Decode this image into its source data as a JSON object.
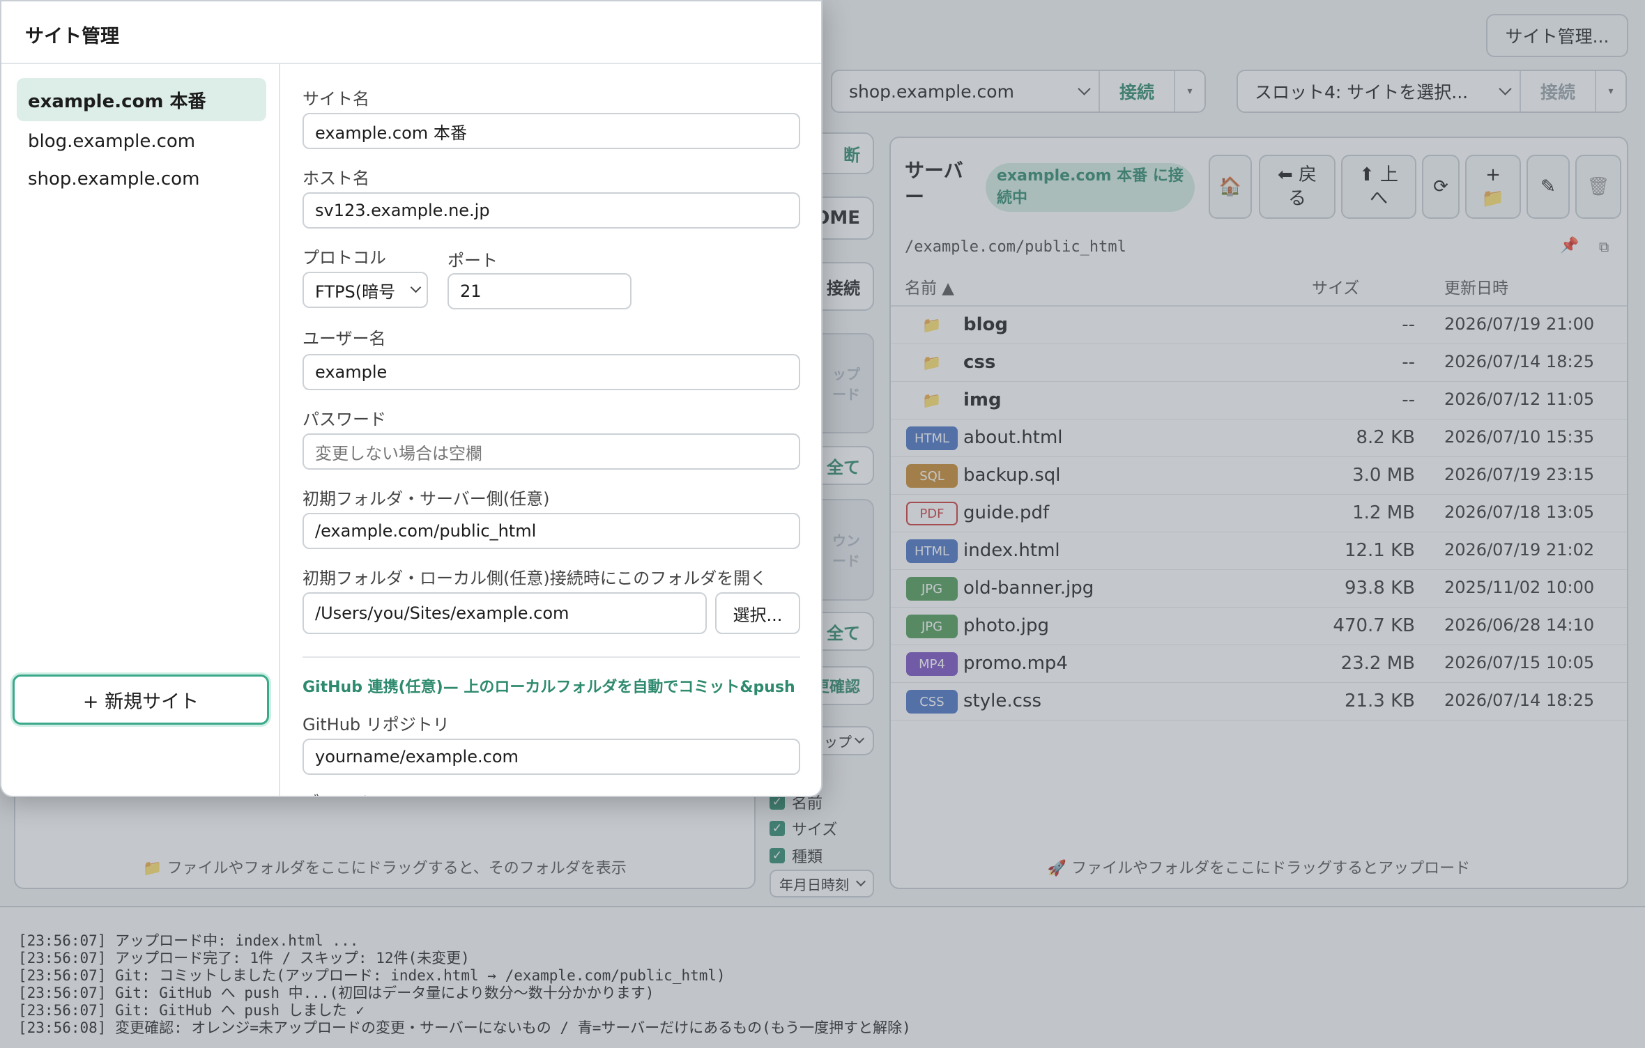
{
  "app": {
    "site_manager_button": "サイト管理...",
    "slot3": {
      "value": "shop.example.com",
      "connect": "接続",
      "dropdown": "▾"
    },
    "slot4": {
      "value": "スロット4: サイトを選択...",
      "connect": "接続",
      "dropdown": "▾"
    },
    "middle": {
      "btn1": "断",
      "btn2": "OME",
      "btn3": "接続",
      "btn4": "ップ\nード",
      "btn5": "全て",
      "btn6": "ウン\nード",
      "btn7": "全て",
      "btn8": "更確認",
      "select1": "ップ",
      "check_name": "名前",
      "check_size": "サイズ",
      "check_type": "種類",
      "date_select": "年月日時刻"
    },
    "local_drop_hint": "📁 ファイルやフォルダをここにドラッグすると、そのフォルダを表示"
  },
  "server": {
    "title": "サーバー",
    "status_badge": "example.com 本番 に接続中",
    "toolbar": {
      "home": "🏠",
      "back": "⬅ 戻る",
      "up": "⬆ 上へ",
      "refresh": "⟳",
      "new_folder": "+ 📁",
      "rename": "✎",
      "delete": "🗑"
    },
    "path": "/example.com/public_html",
    "pin_icon": "📌",
    "copy_icon": "⧉",
    "columns": {
      "name": "名前 ▲",
      "size": "サイズ",
      "modified": "更新日時"
    },
    "files": [
      {
        "type": "folder",
        "badge": "",
        "name": "blog",
        "size": "--",
        "date": "2026/07/19 21:00"
      },
      {
        "type": "folder",
        "badge": "",
        "name": "css",
        "size": "--",
        "date": "2026/07/14 18:25"
      },
      {
        "type": "folder",
        "badge": "",
        "name": "img",
        "size": "--",
        "date": "2026/07/12 11:05"
      },
      {
        "type": "file",
        "badge": "HTML",
        "color": "#4a72c4",
        "name": "about.html",
        "size": "8.2 KB",
        "date": "2026/07/10 15:35"
      },
      {
        "type": "file",
        "badge": "SQL",
        "color": "#c98a2e",
        "name": "backup.sql",
        "size": "3.0 MB",
        "date": "2026/07/19 23:15"
      },
      {
        "type": "file",
        "badge": "PDF",
        "color": "#cc3b3b",
        "name": "guide.pdf",
        "size": "1.2 MB",
        "date": "2026/07/18 13:05"
      },
      {
        "type": "file",
        "badge": "HTML",
        "color": "#4a72c4",
        "name": "index.html",
        "size": "12.1 KB",
        "date": "2026/07/19 21:02"
      },
      {
        "type": "file",
        "badge": "JPG",
        "color": "#4f9a56",
        "name": "old-banner.jpg",
        "size": "93.8 KB",
        "date": "2025/11/02 10:00"
      },
      {
        "type": "file",
        "badge": "JPG",
        "color": "#4f9a56",
        "name": "photo.jpg",
        "size": "470.7 KB",
        "date": "2026/06/28 14:10"
      },
      {
        "type": "file",
        "badge": "MP4",
        "color": "#7b4fc2",
        "name": "promo.mp4",
        "size": "23.2 MB",
        "date": "2026/07/15 10:05"
      },
      {
        "type": "file",
        "badge": "CSS",
        "color": "#4a72c4",
        "name": "style.css",
        "size": "21.3 KB",
        "date": "2026/07/14 18:25"
      }
    ],
    "drop_hint": "🚀 ファイルやフォルダをここにドラッグするとアップロード"
  },
  "log": [
    "[23:56:07] アップロード中: index.html ...",
    "[23:56:07] アップロード完了: 1件 / スキップ: 12件(未変更)",
    "[23:56:07] Git: コミットしました(アップロード: index.html → /example.com/public_html)",
    "[23:56:07] Git: GitHub へ push 中...(初回はデータ量により数分〜数十分かかります)",
    "[23:56:07] Git: GitHub へ push しました ✓",
    "[23:56:08] 変更確認: オレンジ=未アップロードの変更・サーバーにないもの / 青=サーバーだけにあるもの(もう一度押すと解除)"
  ],
  "modal": {
    "title": "サイト管理",
    "sites": [
      "example.com 本番",
      "blog.example.com",
      "shop.example.com"
    ],
    "new_site_button": "+ 新規サイト",
    "form": {
      "site_name_label": "サイト名",
      "site_name": "example.com 本番",
      "host_label": "ホスト名",
      "host": "sv123.example.ne.jp",
      "protocol_label": "プロトコル",
      "protocol": "FTPS(暗号",
      "port_label": "ポート",
      "port": "21",
      "user_label": "ユーザー名",
      "user": "example",
      "password_label": "パスワード",
      "password_placeholder": "変更しない場合は空欄",
      "remote_dir_label": "初期フォルダ・サーバー側(任意)",
      "remote_dir": "/example.com/public_html",
      "local_dir_label": "初期フォルダ・ローカル側(任意)接続時にこのフォルダを開く",
      "local_dir": "/Users/you/Sites/example.com",
      "choose_button": "選択...",
      "github_heading": "GitHub 連携(任意)— 上のローカルフォルダを自動でコミット&push",
      "repo_label": "GitHub リポジトリ",
      "repo": "yourname/example.com",
      "branch_label": "ブランチ"
    }
  }
}
